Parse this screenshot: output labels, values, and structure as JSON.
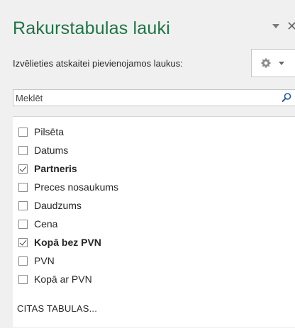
{
  "pane": {
    "title": "Rakurstabulas lauki",
    "subtitle": "Izvēlieties atskaitei pievienojamos laukus:"
  },
  "search": {
    "placeholder": "Meklēt"
  },
  "fields": [
    {
      "label": "Pilsēta",
      "checked": false
    },
    {
      "label": "Datums",
      "checked": false
    },
    {
      "label": "Partneris",
      "checked": true
    },
    {
      "label": "Preces nosaukums",
      "checked": false
    },
    {
      "label": "Daudzums",
      "checked": false
    },
    {
      "label": "Cena",
      "checked": false
    },
    {
      "label": "Kopā bez PVN",
      "checked": true
    },
    {
      "label": "PVN",
      "checked": false
    },
    {
      "label": "Kopā ar PVN",
      "checked": false
    }
  ],
  "more_tables": "CITAS TABULAS...",
  "colors": {
    "title": "#217346",
    "panel_bg": "#f0f0f0",
    "list_bg": "#ffffff"
  },
  "icons": {
    "options": "gear-icon",
    "search": "magnifier-icon",
    "close": "close-icon",
    "menu": "chevron-down-icon"
  }
}
